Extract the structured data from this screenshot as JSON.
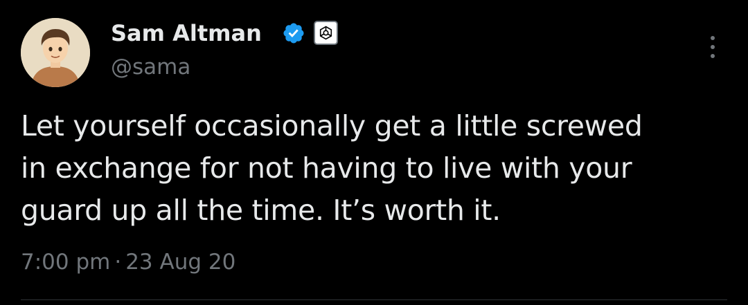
{
  "author": {
    "display_name": "Sam Altman",
    "handle": "@sama",
    "verified_badge_color": "#1d9bf0",
    "affiliate_badge_icon": "openai-logo-icon"
  },
  "tweet": {
    "text_lines": [
      "Let yourself occasionally get a little screwed",
      "in exchange for not having to live with your",
      "guard up all the time. It’s worth it."
    ],
    "time": "7:00 pm",
    "separator": "·",
    "date": "23 Aug 20"
  },
  "colors": {
    "background": "#000000",
    "primary_text": "#e7e9ea",
    "secondary_text": "#71767b",
    "divider": "#2f3336"
  },
  "icons": {
    "more": "more-vertical-icon",
    "verified": "verified-badge-icon",
    "avatar": "avatar-illustration"
  }
}
